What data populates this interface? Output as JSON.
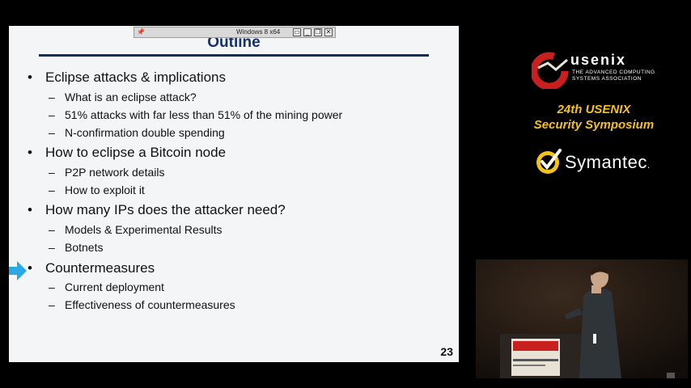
{
  "vm_window": {
    "title": "Windows 8 x64"
  },
  "slide": {
    "title": "Outline",
    "page_number": "23",
    "sections": [
      {
        "label": "Eclipse attacks & implications",
        "items": [
          "What is an eclipse attack?",
          "51% attacks with far less than 51% of the mining power",
          "N-confirmation double spending"
        ]
      },
      {
        "label": "How to eclipse a Bitcoin node",
        "items": [
          "P2P network details",
          "How to exploit it"
        ]
      },
      {
        "label": "How many IPs does the attacker need?",
        "items": [
          "Models & Experimental Results",
          "Botnets"
        ]
      },
      {
        "label": "Countermeasures",
        "items": [
          "Current deployment",
          "Effectiveness of countermeasures"
        ]
      }
    ],
    "current_section_marker": "arrow-icon"
  },
  "branding": {
    "usenix_name": "usenix",
    "usenix_tagline": "THE ADVANCED COMPUTING SYSTEMS ASSOCIATION",
    "conference_line1": "24th USENIX",
    "conference_line2": "Security Symposium",
    "sponsor": "Symantec",
    "sponsor_dot": "."
  },
  "colors": {
    "title_blue": "#16306e",
    "arrow_blue": "#29a9e6",
    "conference_gold": "#f5c21a",
    "usenix_red": "#c8201e"
  }
}
